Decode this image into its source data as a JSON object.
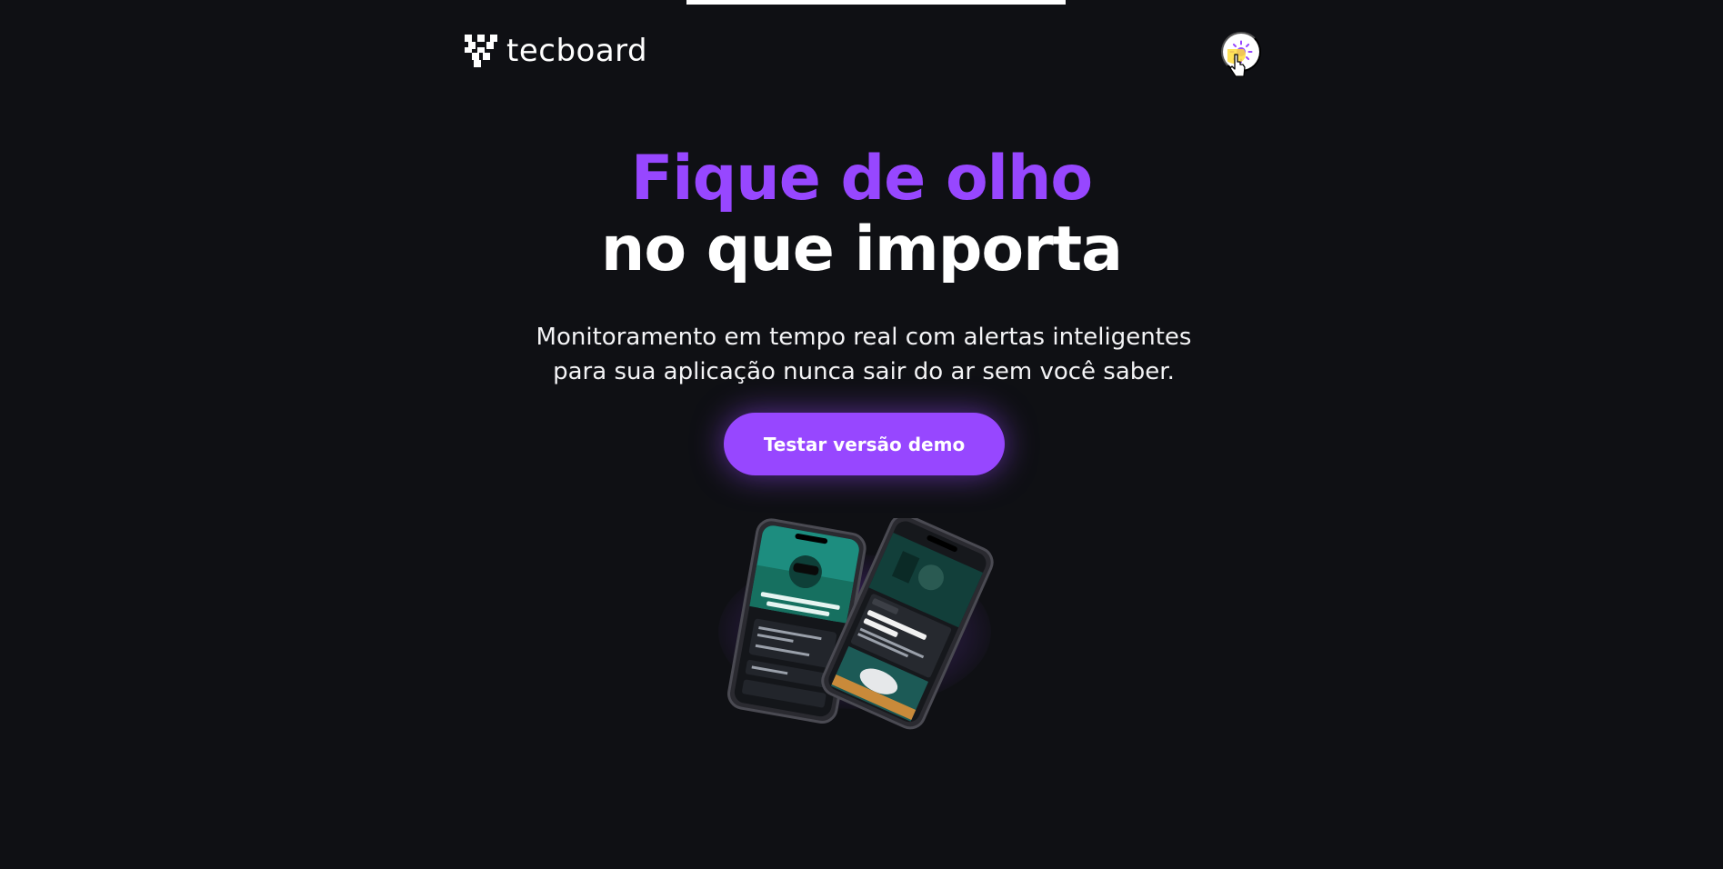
{
  "header": {
    "logo_text": "tecboard",
    "logo_icon": "tecboard-logo-icon",
    "theme_toggle_icon": "sun-icon"
  },
  "hero": {
    "title_line_1": "Fique de olho",
    "title_line_2": "no que importa",
    "subtitle_line_1": "Monitoramento em tempo real com alertas inteligentes",
    "subtitle_line_2": "para sua aplicação nunca sair do ar sem você saber.",
    "cta_label": "Testar versão demo"
  },
  "colors": {
    "background": "#0f1014",
    "accent": "#9747ff",
    "text": "#ffffff"
  }
}
